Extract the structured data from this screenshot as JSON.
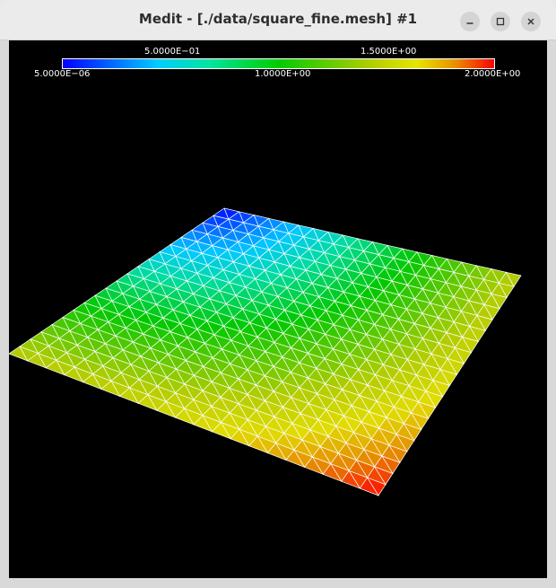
{
  "window": {
    "title": "Medit - [./data/square_fine.mesh] #1",
    "controls": [
      "minimize-icon",
      "maximize-icon",
      "close-icon"
    ]
  },
  "colorbar": {
    "top_labels": [
      "5.0000E−01",
      "1.5000E+00"
    ],
    "bottom_labels": [
      "5.0000E−06",
      "1.0000E+00",
      "2.0000E+00"
    ],
    "min": 5e-06,
    "max": 2.0,
    "colors": [
      "#0000ff",
      "#00ccff",
      "#00cc00",
      "#e6e600",
      "#ff0000"
    ]
  },
  "scene": {
    "background": "#000000",
    "mesh_edge_color": "#ffffff",
    "mesh": "square_fine.mesh",
    "grid_divisions": 20
  }
}
